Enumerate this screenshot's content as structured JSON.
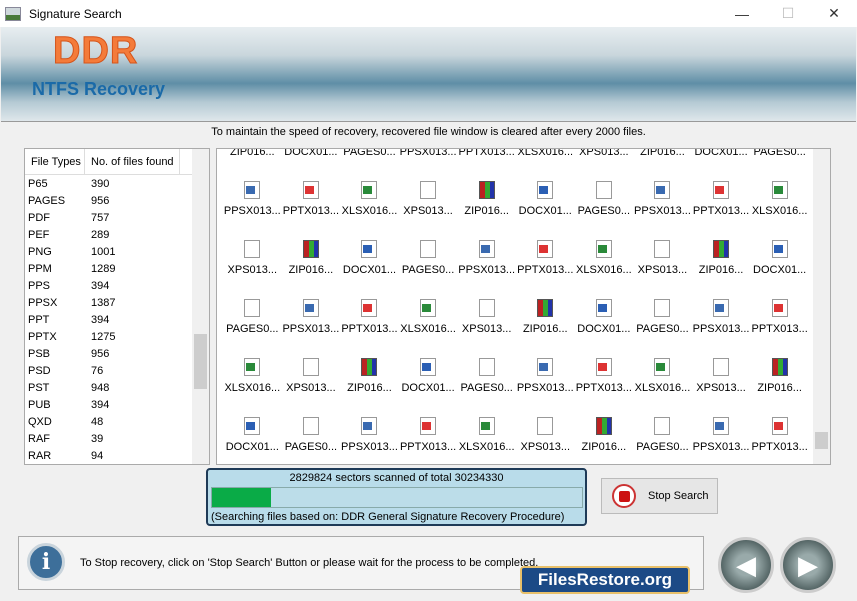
{
  "window": {
    "title": "Signature Search",
    "minimize": "—",
    "maximize": "☐",
    "close": "✕"
  },
  "banner": {
    "brand": "DDR",
    "product": "NTFS Recovery"
  },
  "notice": "To maintain the speed of recovery, recovered file window is cleared after every 2000 files.",
  "file_types": {
    "headers": [
      "File Types",
      "No. of files found"
    ],
    "rows": [
      [
        "P65",
        "390"
      ],
      [
        "PAGES",
        "956"
      ],
      [
        "PDF",
        "757"
      ],
      [
        "PEF",
        "289"
      ],
      [
        "PNG",
        "1001"
      ],
      [
        "PPM",
        "1289"
      ],
      [
        "PPS",
        "394"
      ],
      [
        "PPSX",
        "1387"
      ],
      [
        "PPT",
        "394"
      ],
      [
        "PPTX",
        "1275"
      ],
      [
        "PSB",
        "956"
      ],
      [
        "PSD",
        "76"
      ],
      [
        "PST",
        "948"
      ],
      [
        "PUB",
        "394"
      ],
      [
        "QXD",
        "48"
      ],
      [
        "RAF",
        "39"
      ],
      [
        "RAR",
        "94"
      ]
    ]
  },
  "files": [
    "ZIP016...",
    "DOCX01...",
    "PAGES0...",
    "PPSX013...",
    "PPTX013...",
    "XLSX016...",
    "XPS013...",
    "ZIP016...",
    "DOCX01...",
    "PAGES0...",
    "PPSX013...",
    "PPTX013...",
    "XLSX016...",
    "XPS013...",
    "ZIP016...",
    "DOCX01...",
    "PAGES0...",
    "PPSX013...",
    "PPTX013...",
    "XLSX016...",
    "XPS013...",
    "ZIP016...",
    "DOCX01...",
    "PAGES0...",
    "PPSX013...",
    "PPTX013...",
    "XLSX016...",
    "XPS013...",
    "ZIP016...",
    "DOCX01...",
    "PAGES0...",
    "PPSX013...",
    "PPTX013...",
    "XLSX016...",
    "XPS013...",
    "ZIP016...",
    "DOCX01...",
    "PAGES0...",
    "PPSX013...",
    "PPTX013...",
    "XLSX016...",
    "XPS013...",
    "ZIP016...",
    "DOCX01...",
    "PAGES0...",
    "PPSX013...",
    "PPTX013...",
    "XLSX016...",
    "XPS013...",
    "ZIP016...",
    "DOCX01...",
    "PAGES0...",
    "PPSX013...",
    "PPTX013...",
    "XLSX016...",
    "XPS013...",
    "ZIP016...",
    "PAGES0...",
    "PPSX013...",
    "PPTX013..."
  ],
  "progress": {
    "text": "2829824 sectors scanned of total 30234330",
    "fraction": 0.16,
    "method": "(Searching files based on:  DDR General Signature Recovery Procedure)",
    "color": "#0aab47"
  },
  "stop_button": "Stop Search",
  "info": {
    "icon": "i",
    "text": "To Stop recovery, click on 'Stop Search' Button or please wait for the process to be completed."
  },
  "nav": {
    "back": "◀",
    "next": "▶"
  },
  "logo": "FilesRestore.org"
}
